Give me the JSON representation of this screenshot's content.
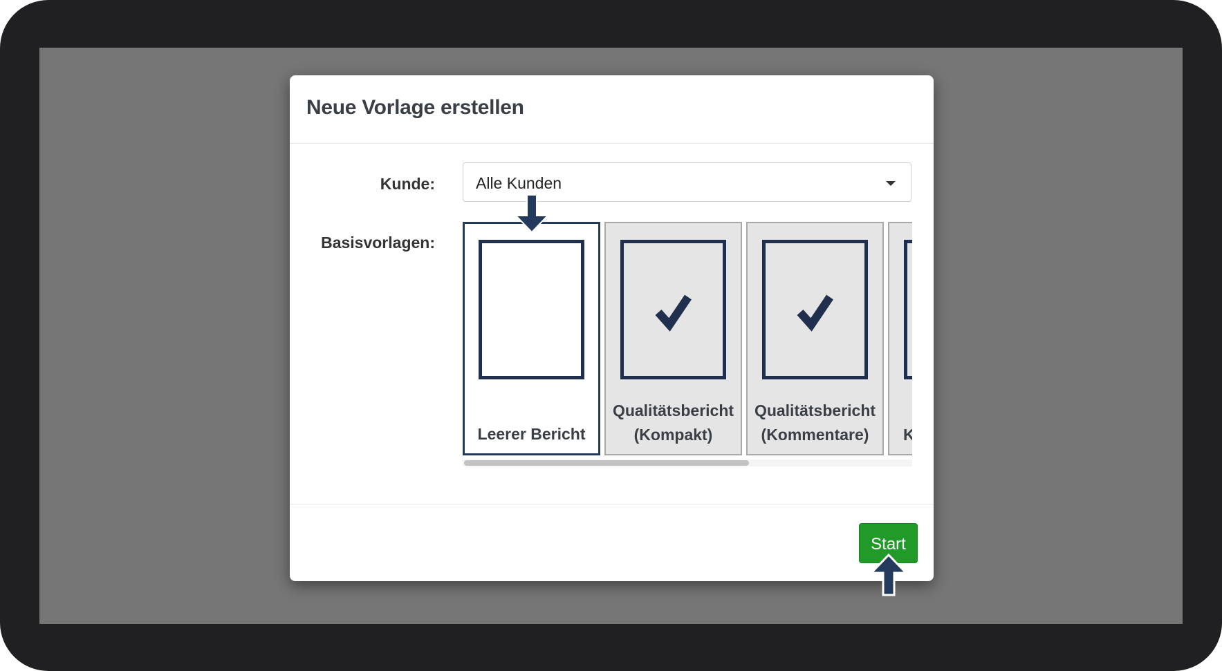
{
  "dialog": {
    "title": "Neue Vorlage erstellen",
    "customer_label": "Kunde:",
    "customer_value": "Alle Kunden",
    "templates_label": "Basisvorlagen:",
    "templates": [
      {
        "label": "Leerer Bericht",
        "selected": true,
        "icon": "blank-document-icon"
      },
      {
        "label": "Qualitätsbericht\n(Kompakt)",
        "selected": false,
        "icon": "checkmark-document-icon"
      },
      {
        "label": "Qualitätsbericht\n(Kommentare)",
        "selected": false,
        "icon": "checkmark-document-icon"
      },
      {
        "label": "K",
        "selected": false,
        "icon": "document-icon"
      }
    ],
    "start_label": "Start"
  },
  "annotations": {
    "arrow_color": "#233a5c",
    "arrows": [
      "arrow-down-icon",
      "arrow-up-icon"
    ]
  },
  "colors": {
    "start_button": "#229a2a",
    "selected_border": "#233a5c",
    "overlay": "#767676"
  }
}
